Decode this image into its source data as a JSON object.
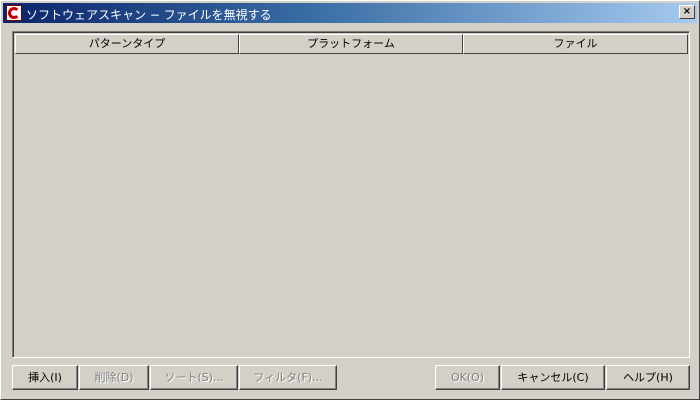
{
  "window": {
    "title": "ソフトウェアスキャン − ファイルを無視する",
    "close_label": "×"
  },
  "table": {
    "columns": [
      "パターンタイプ",
      "プラットフォーム",
      "ファイル"
    ],
    "rows": []
  },
  "buttons": {
    "insert": "挿入(I)",
    "delete": "削除(D)",
    "sort": "ソート(S)...",
    "filter": "フィルタ(F)...",
    "ok": "OK(O)",
    "cancel": "キャンセル(C)",
    "help": "ヘルプ(H)"
  }
}
